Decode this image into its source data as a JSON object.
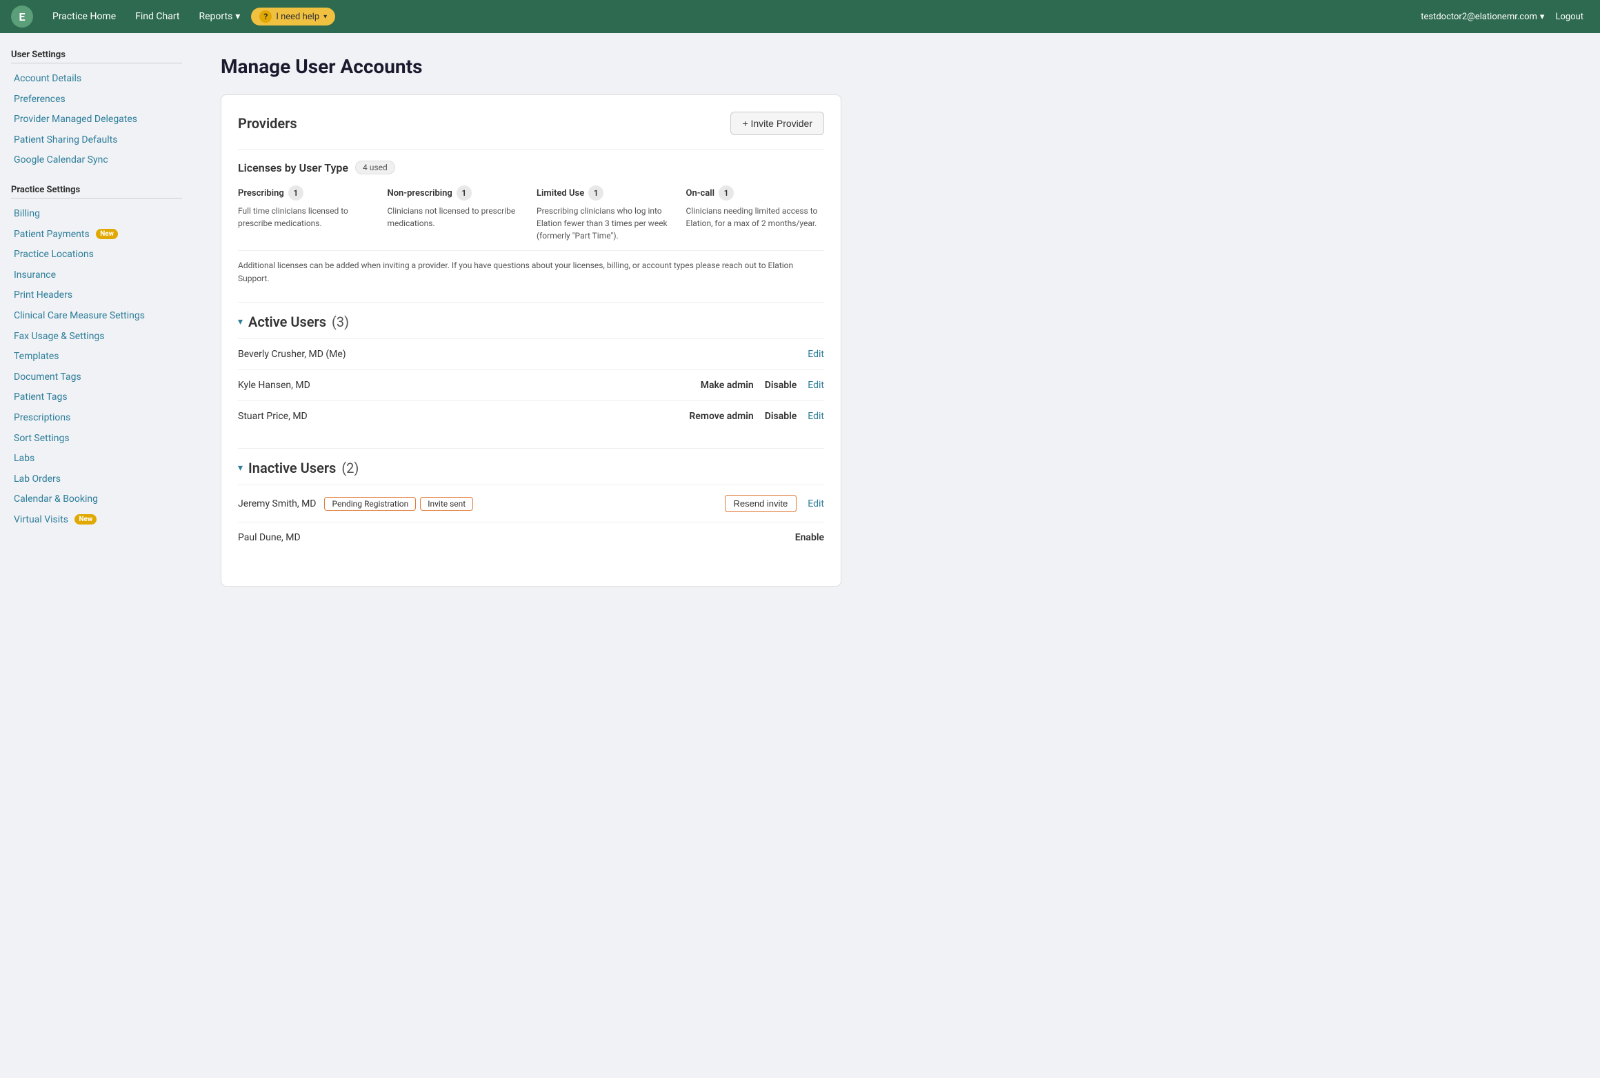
{
  "topNav": {
    "logo": "E",
    "items": [
      {
        "id": "practice-home",
        "label": "Practice Home"
      },
      {
        "id": "find-chart",
        "label": "Find Chart"
      },
      {
        "id": "reports",
        "label": "Reports",
        "hasDropdown": true
      }
    ],
    "help": {
      "label": "I need help",
      "hasDropdown": true
    },
    "user": {
      "email": "testdoctor2@elationemr.com",
      "hasDropdown": true
    },
    "logout": "Logout"
  },
  "sidebar": {
    "userSettingsTitle": "User Settings",
    "userSettingsLinks": [
      {
        "id": "account-details",
        "label": "Account Details"
      },
      {
        "id": "preferences",
        "label": "Preferences"
      },
      {
        "id": "provider-managed-delegates",
        "label": "Provider Managed Delegates"
      },
      {
        "id": "patient-sharing-defaults",
        "label": "Patient Sharing Defaults"
      },
      {
        "id": "google-calendar-sync",
        "label": "Google Calendar Sync"
      }
    ],
    "practiceSettingsTitle": "Practice Settings",
    "practiceSettingsLinks": [
      {
        "id": "billing",
        "label": "Billing",
        "badge": null
      },
      {
        "id": "patient-payments",
        "label": "Patient Payments",
        "badge": "New"
      },
      {
        "id": "practice-locations",
        "label": "Practice Locations",
        "badge": null
      },
      {
        "id": "insurance",
        "label": "Insurance",
        "badge": null
      },
      {
        "id": "print-headers",
        "label": "Print Headers",
        "badge": null
      },
      {
        "id": "clinical-care-measure-settings",
        "label": "Clinical Care Measure Settings",
        "badge": null
      },
      {
        "id": "fax-usage-settings",
        "label": "Fax Usage & Settings",
        "badge": null
      },
      {
        "id": "templates",
        "label": "Templates",
        "badge": null
      },
      {
        "id": "document-tags",
        "label": "Document Tags",
        "badge": null
      },
      {
        "id": "patient-tags",
        "label": "Patient Tags",
        "badge": null
      },
      {
        "id": "prescriptions",
        "label": "Prescriptions",
        "badge": null
      },
      {
        "id": "sort-settings",
        "label": "Sort Settings",
        "badge": null
      },
      {
        "id": "labs",
        "label": "Labs",
        "badge": null
      },
      {
        "id": "lab-orders",
        "label": "Lab Orders",
        "badge": null
      },
      {
        "id": "calendar-booking",
        "label": "Calendar & Booking",
        "badge": null
      },
      {
        "id": "virtual-visits",
        "label": "Virtual Visits",
        "badge": "New"
      }
    ]
  },
  "pageTitle": "Manage User Accounts",
  "card": {
    "providersTitle": "Providers",
    "inviteButton": "+ Invite Provider",
    "licenses": {
      "title": "Licenses by User Type",
      "used": "4 used",
      "types": [
        {
          "id": "prescribing",
          "name": "Prescribing",
          "count": "1",
          "description": "Full time clinicians licensed to prescribe medications."
        },
        {
          "id": "non-prescribing",
          "name": "Non-prescribing",
          "count": "1",
          "description": "Clinicians not licensed to prescribe medications."
        },
        {
          "id": "limited-use",
          "name": "Limited Use",
          "count": "1",
          "description": "Prescribing clinicians who log into Elation fewer than 3 times per week (formerly \"Part Time\")."
        },
        {
          "id": "on-call",
          "name": "On-call",
          "count": "1",
          "description": "Clinicians needing limited access to Elation, for a max of 2 months/year."
        }
      ],
      "note": "Additional licenses can be added when inviting a provider. If you have questions about your licenses, billing, or account types please reach out to Elation Support."
    },
    "activeUsers": {
      "title": "Active Users",
      "count": "(3)",
      "users": [
        {
          "id": "beverly-crusher",
          "name": "Beverly Crusher, MD (Me)",
          "actions": [
            {
              "id": "edit",
              "label": "Edit",
              "style": "link"
            }
          ]
        },
        {
          "id": "kyle-hansen",
          "name": "Kyle Hansen, MD",
          "actions": [
            {
              "id": "make-admin",
              "label": "Make admin",
              "style": "bold"
            },
            {
              "id": "disable",
              "label": "Disable",
              "style": "bold"
            },
            {
              "id": "edit",
              "label": "Edit",
              "style": "link"
            }
          ]
        },
        {
          "id": "stuart-price",
          "name": "Stuart Price, MD",
          "actions": [
            {
              "id": "remove-admin",
              "label": "Remove admin",
              "style": "bold"
            },
            {
              "id": "disable",
              "label": "Disable",
              "style": "bold"
            },
            {
              "id": "edit",
              "label": "Edit",
              "style": "link"
            }
          ]
        }
      ]
    },
    "inactiveUsers": {
      "title": "Inactive Users",
      "count": "(2)",
      "users": [
        {
          "id": "jeremy-smith",
          "name": "Jeremy Smith, MD",
          "pendingBadge": "Pending Registration",
          "inviteBadge": "Invite sent",
          "isPending": true,
          "actions": [
            {
              "id": "resend-invite",
              "label": "Resend invite",
              "style": "resend"
            },
            {
              "id": "edit",
              "label": "Edit",
              "style": "link"
            }
          ]
        },
        {
          "id": "paul-dune",
          "name": "Paul Dune, MD",
          "isPending": false,
          "actions": [
            {
              "id": "enable",
              "label": "Enable",
              "style": "bold"
            }
          ]
        }
      ]
    }
  }
}
